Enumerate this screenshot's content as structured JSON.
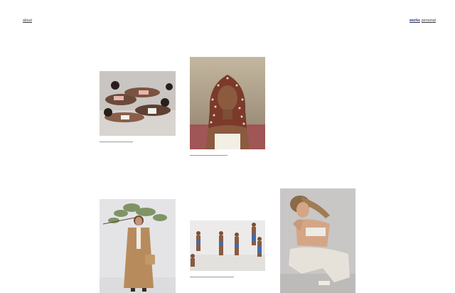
{
  "nav": {
    "about": "about",
    "works": "works",
    "personal": "personal"
  },
  "colors": {
    "accent": "#1f2a5c",
    "caption_line": "#9a9a9a",
    "background": "#ffffff"
  },
  "gallery": {
    "images": [
      {
        "name": "group-lying-photo",
        "depicts": "group of women lying on the floor"
      },
      {
        "name": "beaded-hair-portrait",
        "depicts": "woman with beaded hair portrait"
      },
      {
        "name": "trench-coat-branch-photo",
        "depicts": "woman in trench coat with olive branch"
      },
      {
        "name": "dancers-group-photo",
        "depicts": "dancers in white studio"
      },
      {
        "name": "crouching-woman-photo",
        "depicts": "crouching woman in white outfit"
      }
    ]
  }
}
